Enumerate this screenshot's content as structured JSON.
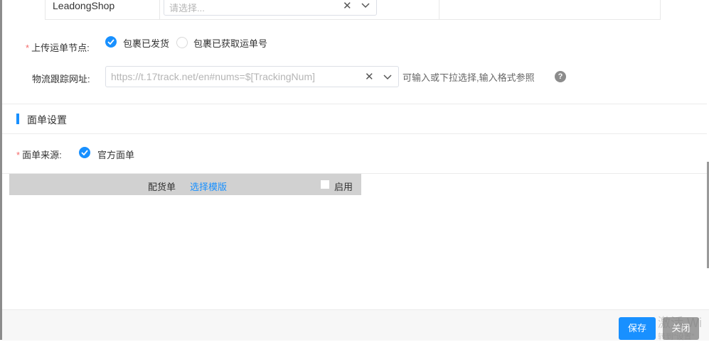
{
  "shop_row": {
    "shop_name": "LeadongShop",
    "select_placeholder": "请选择..."
  },
  "upload_node": {
    "label": "上传运单节点:",
    "options": [
      {
        "label": "包裹已发货",
        "checked": true
      },
      {
        "label": "包裹已获取运单号",
        "checked": false
      }
    ]
  },
  "tracking_url": {
    "label": "物流跟踪网址:",
    "placeholder": "https://t.17track.net/en#nums=$[TrackingNum]",
    "hint": "可输入或下拉选择,输入格式参照",
    "help": "?"
  },
  "waybill_section": {
    "title": "面单设置",
    "source_label": "面单来源:",
    "source_option": "官方面单"
  },
  "template_row": {
    "name": "配货单",
    "select_link": "选择模版",
    "enable_label": "启用"
  },
  "footer": {
    "save_label": "保存",
    "close_label": "关闭"
  },
  "watermark": {
    "line1": "激活 Wi",
    "line2": "转到“设置”"
  },
  "colors": {
    "primary": "#1890ff",
    "required": "#f56c6c",
    "close_button": "#9e9e9e"
  }
}
